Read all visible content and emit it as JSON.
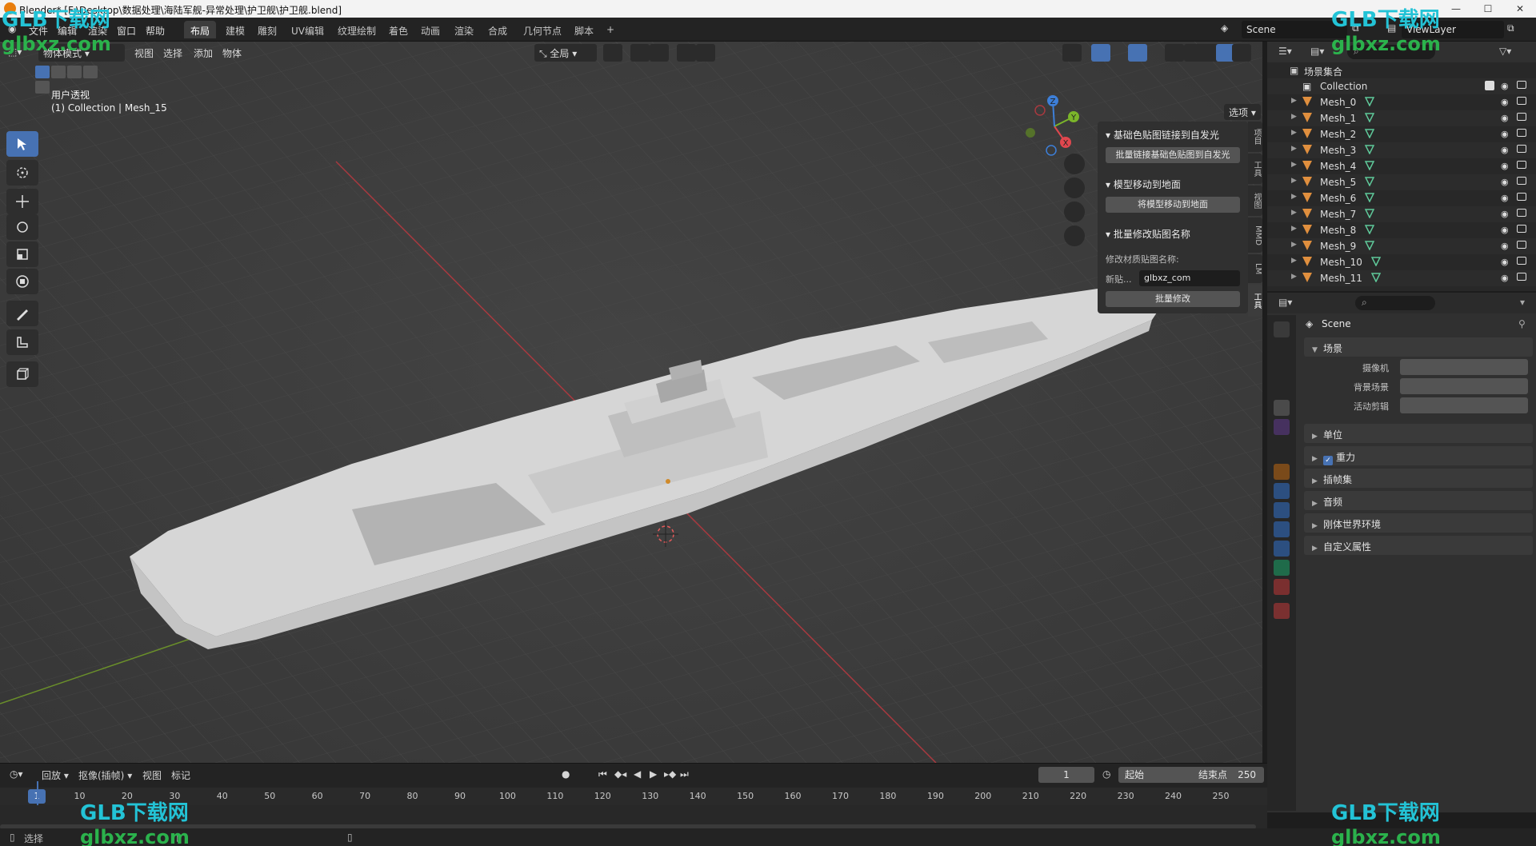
{
  "window": {
    "title": "Blender* [F:\\Desktop\\数据处理\\海陆军舰-异常处理\\护卫舰\\护卫舰.blend]"
  },
  "menu": [
    "文件",
    "编辑",
    "渲染",
    "窗口",
    "帮助"
  ],
  "workspaces": {
    "tabs": [
      "布局",
      "建模",
      "雕刻",
      "UV编辑",
      "纹理绘制",
      "着色",
      "动画",
      "渲染",
      "合成",
      "几何节点",
      "脚本"
    ],
    "active": "布局",
    "add": "+"
  },
  "scene_selector": "Scene",
  "viewlayer_selector": "ViewLayer",
  "viewport_header": {
    "mode": "物体模式",
    "menus": [
      "视图",
      "选择",
      "添加",
      "物体"
    ],
    "transform_orientation": "全局",
    "options": "选项"
  },
  "viewport": {
    "view_name": "用户透视",
    "collection_info": "(1) Collection | Mesh_15",
    "gizmo_axes": {
      "x": "X",
      "y": "Y",
      "z": "Z"
    },
    "colors": {
      "x_axis": "#e0474e",
      "y_axis": "#7bb52a",
      "z_axis": "#3d7fd8"
    }
  },
  "npanel": {
    "sections": [
      {
        "title": "基础色贴图链接到自发光",
        "button": "批量链接基础色贴图到自发光"
      },
      {
        "title": "模型移动到地面",
        "button": "将模型移动到地面"
      },
      {
        "title": "批量修改贴图名称",
        "label": "修改材质贴图名称:",
        "field_label": "新贴...",
        "field_value": "glbxz_com",
        "button": "批量修改"
      }
    ],
    "side_tabs": [
      "项目",
      "工具",
      "视图",
      "MMD",
      "LM",
      "工具"
    ]
  },
  "outliner": {
    "root": "场景集合",
    "collection": "Collection",
    "objects": [
      "Mesh_0",
      "Mesh_1",
      "Mesh_2",
      "Mesh_3",
      "Mesh_4",
      "Mesh_5",
      "Mesh_6",
      "Mesh_7",
      "Mesh_8",
      "Mesh_9",
      "Mesh_10",
      "Mesh_11"
    ]
  },
  "properties": {
    "context_name": "Scene",
    "scene_section": "场景",
    "fields": [
      {
        "label": "摄像机"
      },
      {
        "label": "背景场景"
      },
      {
        "label": "活动剪辑"
      }
    ],
    "panels": [
      "单位",
      "重力",
      "插帧集",
      "音频",
      "刚体世界环境",
      "自定义属性"
    ],
    "gravity_checked": true
  },
  "timeline": {
    "menus": [
      "回放",
      "抠像(插帧)",
      "视图",
      "标记"
    ],
    "current_frame": "1",
    "start_label": "起始",
    "start_value": "1",
    "end_label": "结束点",
    "end_value": "250",
    "ruler_ticks": [
      "1",
      "10",
      "20",
      "30",
      "40",
      "50",
      "60",
      "70",
      "80",
      "90",
      "100",
      "110",
      "120",
      "130",
      "140",
      "150",
      "160",
      "170",
      "180",
      "190",
      "200",
      "210",
      "220",
      "230",
      "240",
      "250"
    ]
  },
  "status_bar": {
    "left": "选择"
  },
  "watermarks": {
    "brand": "GLB下载网",
    "url": "glbxz.com"
  }
}
